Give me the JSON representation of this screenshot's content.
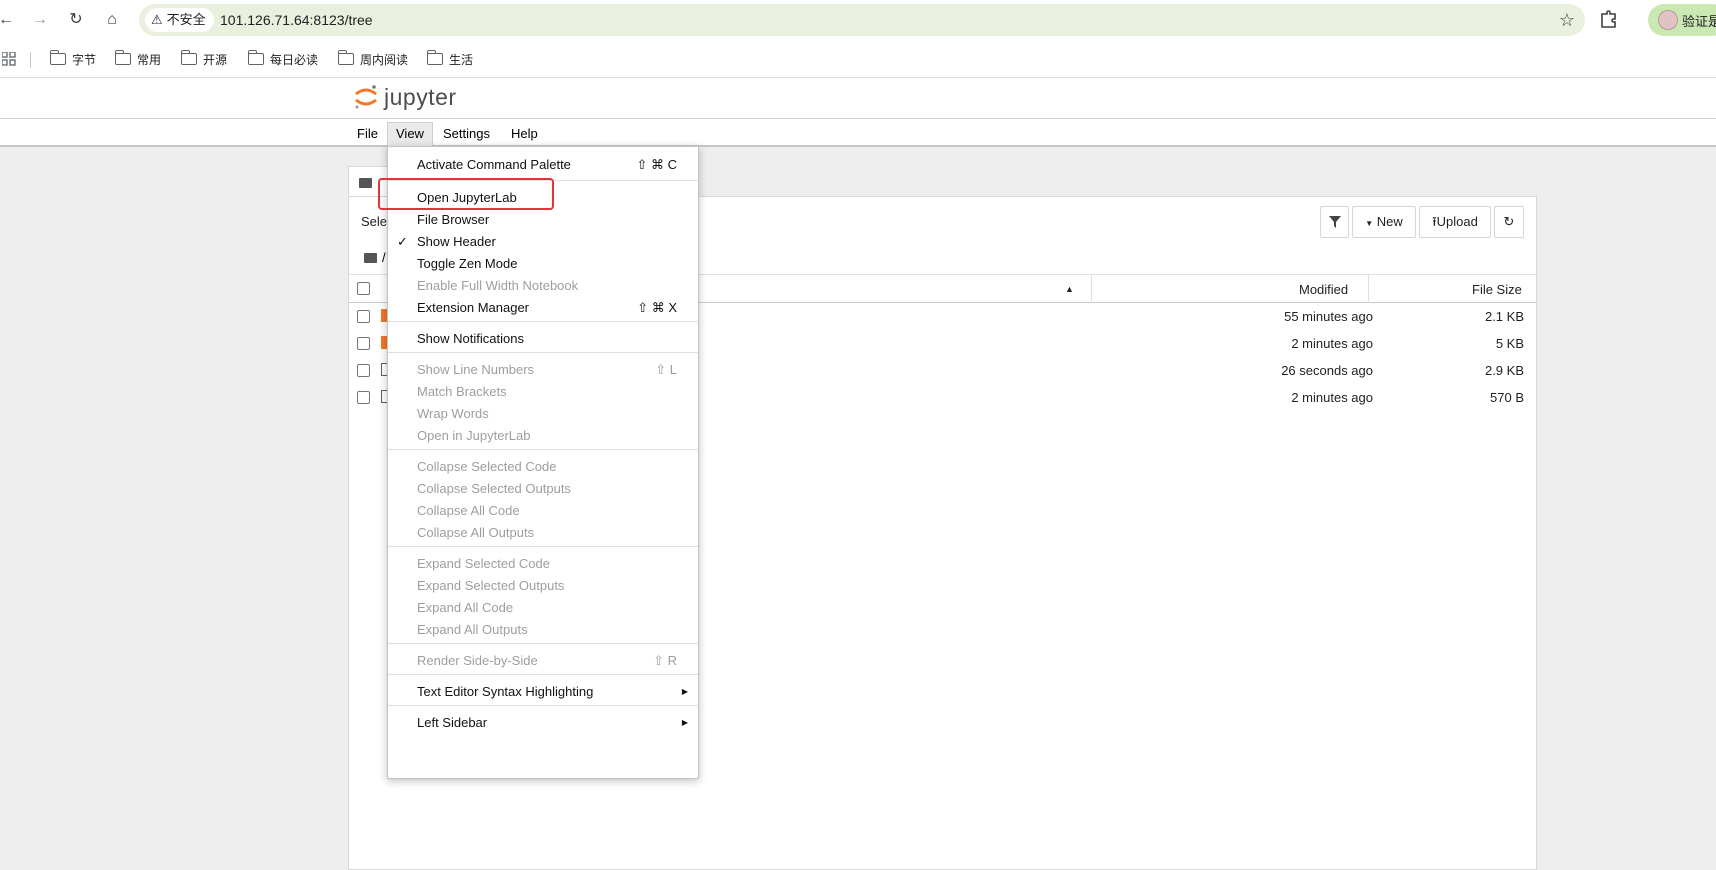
{
  "browser": {
    "security_label": "不安全",
    "url": "101.126.71.64:8123/tree",
    "profile_label": "验证是"
  },
  "bookmarks": [
    "字节",
    "常用",
    "开源",
    "每日必读",
    "周内阅读",
    "生活"
  ],
  "jupyter": {
    "logo_text": "jupyter",
    "menus": [
      "File",
      "View",
      "Settings",
      "Help"
    ],
    "active_menu": "View"
  },
  "file_browser": {
    "select_text_partial": "Sele",
    "breadcrumb": "/",
    "toolbar": {
      "new_label": "New",
      "upload_label": "Upload"
    },
    "columns": {
      "modified": "Modified",
      "size": "File Size"
    },
    "rows": [
      {
        "modified": "55 minutes ago",
        "size": "2.1 KB",
        "icon_color": "#f37726"
      },
      {
        "modified": "2 minutes ago",
        "size": "5 KB",
        "icon_color": "#f37726"
      },
      {
        "modified": "26 seconds ago",
        "size": "2.9 KB",
        "icon_color": "#616161"
      },
      {
        "modified": "2 minutes ago",
        "size": "570 B",
        "icon_color": "#616161"
      }
    ]
  },
  "view_menu": {
    "groups": [
      [
        {
          "label": "Activate Command Palette",
          "shortcut": "⇧ ⌘ C",
          "enabled": true
        }
      ],
      [
        {
          "label": "Open JupyterLab",
          "shortcut": "",
          "enabled": true,
          "highlighted": true
        },
        {
          "label": "File Browser",
          "shortcut": "",
          "enabled": true
        },
        {
          "label": "Show Header",
          "shortcut": "",
          "enabled": true,
          "checked": true
        },
        {
          "label": "Toggle Zen Mode",
          "shortcut": "",
          "enabled": true
        },
        {
          "label": "Enable Full Width Notebook",
          "shortcut": "",
          "enabled": false
        },
        {
          "label": "Extension Manager",
          "shortcut": "⇧ ⌘ X",
          "enabled": true
        }
      ],
      [
        {
          "label": "Show Notifications",
          "shortcut": "",
          "enabled": true
        }
      ],
      [
        {
          "label": "Show Line Numbers",
          "shortcut": "⇧ L",
          "enabled": false
        },
        {
          "label": "Match Brackets",
          "shortcut": "",
          "enabled": false
        },
        {
          "label": "Wrap Words",
          "shortcut": "",
          "enabled": false
        },
        {
          "label": "Open in JupyterLab",
          "shortcut": "",
          "enabled": false
        }
      ],
      [
        {
          "label": "Collapse Selected Code",
          "shortcut": "",
          "enabled": false
        },
        {
          "label": "Collapse Selected Outputs",
          "shortcut": "",
          "enabled": false
        },
        {
          "label": "Collapse All Code",
          "shortcut": "",
          "enabled": false
        },
        {
          "label": "Collapse All Outputs",
          "shortcut": "",
          "enabled": false
        }
      ],
      [
        {
          "label": "Expand Selected Code",
          "shortcut": "",
          "enabled": false
        },
        {
          "label": "Expand Selected Outputs",
          "shortcut": "",
          "enabled": false
        },
        {
          "label": "Expand All Code",
          "shortcut": "",
          "enabled": false
        },
        {
          "label": "Expand All Outputs",
          "shortcut": "",
          "enabled": false
        }
      ],
      [
        {
          "label": "Render Side-by-Side",
          "shortcut": "⇧ R",
          "enabled": false
        }
      ],
      [
        {
          "label": "Text Editor Syntax Highlighting",
          "shortcut": "",
          "enabled": true,
          "submenu": true
        }
      ],
      [
        {
          "label": "Left Sidebar",
          "shortcut": "",
          "enabled": true,
          "submenu": true
        }
      ]
    ]
  },
  "colors": {
    "jupyter_orange": "#f37726",
    "highlight_red": "#e0353b",
    "omnibox_bg": "#e9f0dd"
  }
}
